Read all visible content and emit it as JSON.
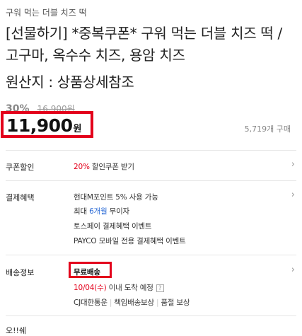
{
  "product": {
    "subtitle": "구워 먹는 더블 치즈 떡",
    "title": "[선물하기] *중복쿠폰* 구워 먹는 더블 치즈 떡 / 고구마, 옥수수 치즈, 용암 치즈",
    "origin": "원산지 : 상품상세참조",
    "discount": "30%",
    "original_price": "16,900원",
    "price": "11,900",
    "price_unit": "원",
    "sold_count": "5,719개 구매"
  },
  "coupon": {
    "label": "쿠폰할인",
    "percent": "20%",
    "text": "할인쿠폰 받기"
  },
  "payment": {
    "label": "결제혜택",
    "line1": "현대M포인트 5% 사용 가능",
    "line2_prefix": "최대 ",
    "line2_highlight": "6개월",
    "line2_suffix": " 무이자",
    "line3": "토스페이 결제혜택 이벤트",
    "line4": "PAYCO 모바일 전용 결제혜택 이벤트"
  },
  "shipping": {
    "label": "배송정보",
    "free": "무료배송",
    "date": "10/04(수)",
    "date_suffix": "이내 도착 예정",
    "help": "?",
    "courier": "CJ대한통운",
    "compensation": "책임배송보상",
    "quality": "품절 보상"
  },
  "cut_label": "오!!쉐"
}
